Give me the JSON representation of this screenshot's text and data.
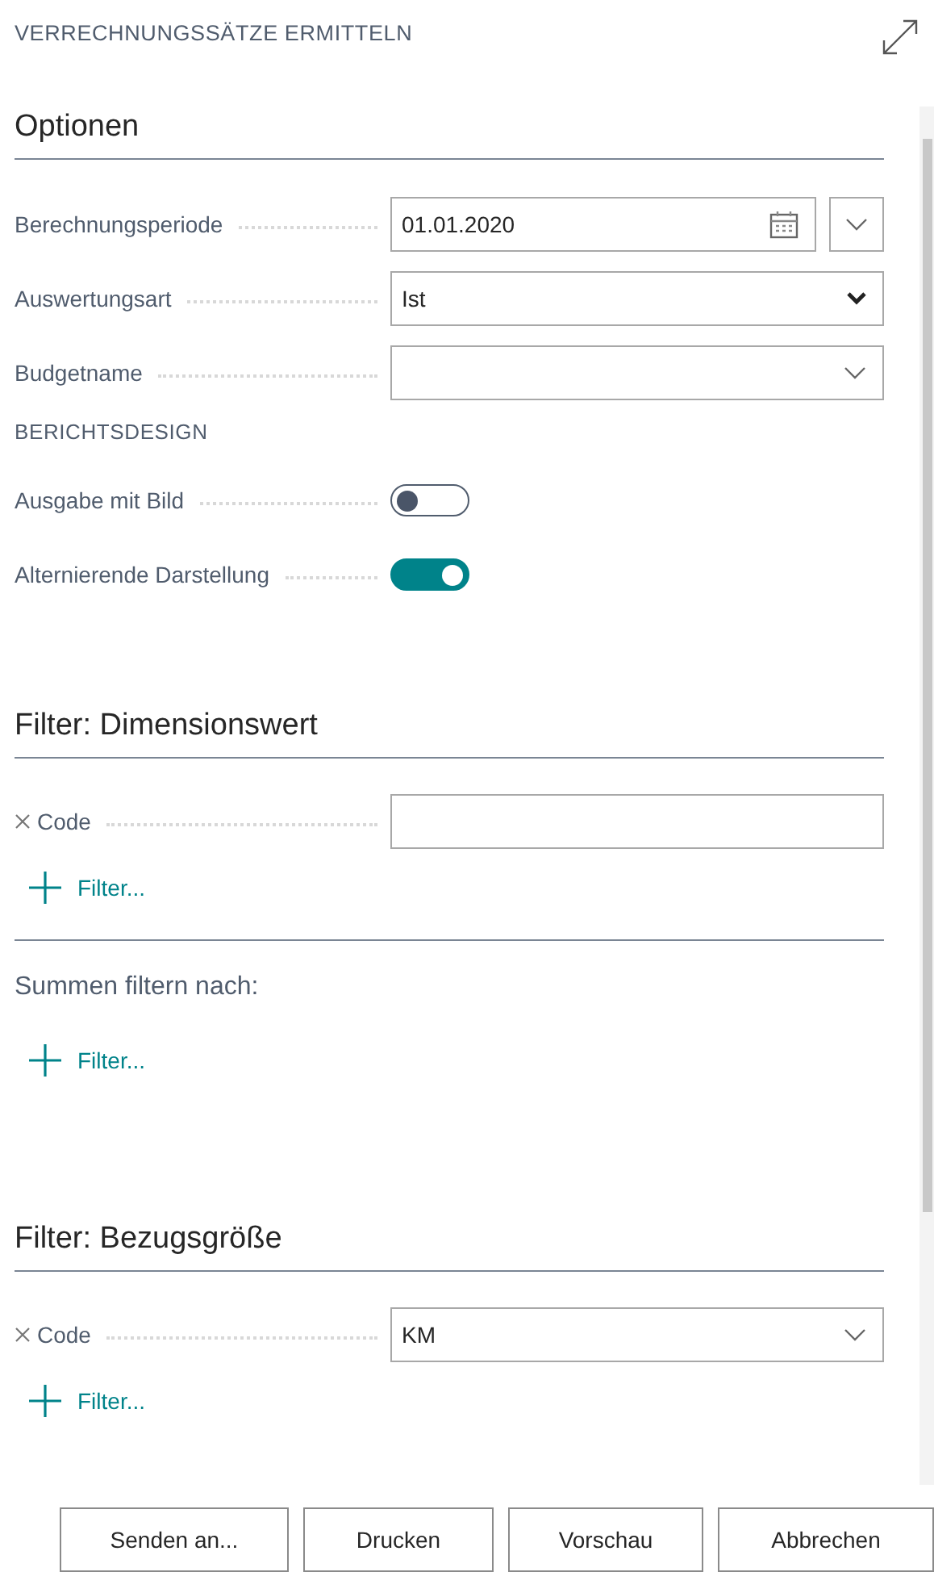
{
  "dialog": {
    "title": "VERRECHNUNGSSÄTZE ERMITTELN"
  },
  "sections": [
    {
      "kind": "options",
      "heading": "Optionen",
      "fields": [
        {
          "kind": "date",
          "label": "Berechnungsperiode",
          "value": "01.01.2020"
        },
        {
          "kind": "select",
          "label": "Auswertungsart",
          "value": "Ist"
        },
        {
          "kind": "combo",
          "label": "Budgetname"
        }
      ],
      "subheading": "BERICHTSDESIGN",
      "toggles": [
        {
          "label": "Ausgabe mit Bild",
          "on": false
        },
        {
          "label": "Alternierende Darstellung",
          "on": true
        }
      ]
    },
    {
      "kind": "filter",
      "heading": "Filter: Dimensionswert",
      "fields": [
        {
          "kind": "text",
          "label": "Code",
          "removable": true
        }
      ],
      "add_filter": "Filter..."
    },
    {
      "kind": "totals",
      "heading": "Summen filtern nach:",
      "add_filter": "Filter..."
    },
    {
      "kind": "filter",
      "heading": "Filter: Bezugsgröße",
      "fields": [
        {
          "kind": "combo",
          "label": "Code",
          "value": "KM",
          "removable": true
        }
      ],
      "add_filter": "Filter..."
    }
  ],
  "buttons": [
    "Senden an...",
    "Drucken",
    "Vorschau",
    "Abbrechen"
  ]
}
